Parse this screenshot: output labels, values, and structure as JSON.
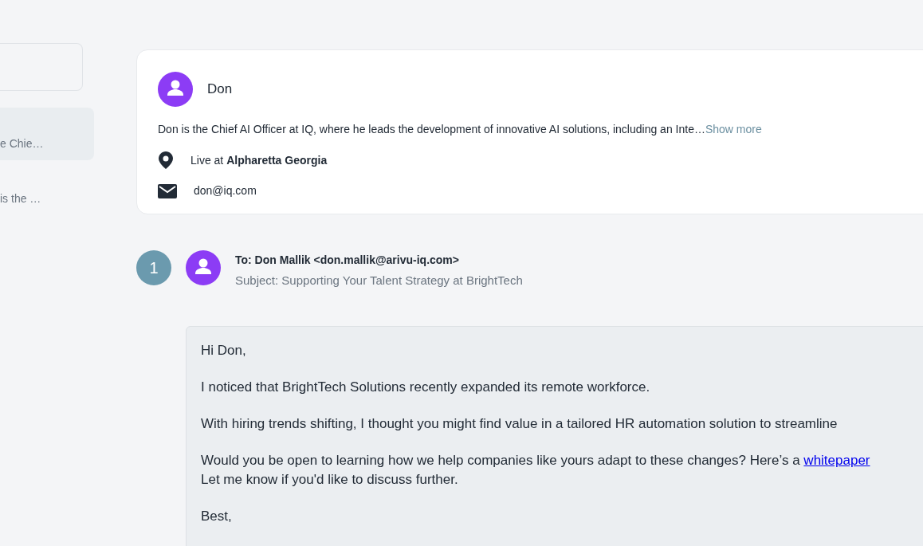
{
  "sidebar": {
    "items": [
      {
        "snippet": "e Chie…",
        "selected": true
      },
      {
        "snippet": "is the …",
        "selected": false
      }
    ]
  },
  "profile": {
    "name": "Don",
    "bio": "Don is the Chief AI Officer at IQ, where he leads the development of innovative AI solutions, including an Inte…",
    "show_more": "Show more",
    "location": "Live at **Alpharetta Georgia**",
    "email": "don@iq.com"
  },
  "emails": [
    {
      "number": "1",
      "to": "To: Don Mallik <don.mallik@arivu-iq.com>",
      "subject": "Subject: Supporting Your Talent Strategy at BrightTech",
      "body": [
        {
          "kind": "text",
          "text": "Hi Don,"
        },
        {
          "kind": "text",
          "text": "I noticed that BrightTech Solutions recently expanded its remote workforce."
        },
        {
          "kind": "text",
          "text": "With hiring trends shifting, I thought you might find value in a tailored HR automation solution to streamline"
        },
        {
          "kind": "link",
          "before": "Would you be open to learning how we help companies like yours adapt to these changes? Here’s a",
          "link": "whitepaper",
          "after": "Let me know if you'd like to discuss further."
        },
        {
          "kind": "text",
          "text": "Best,"
        }
      ]
    }
  ]
}
